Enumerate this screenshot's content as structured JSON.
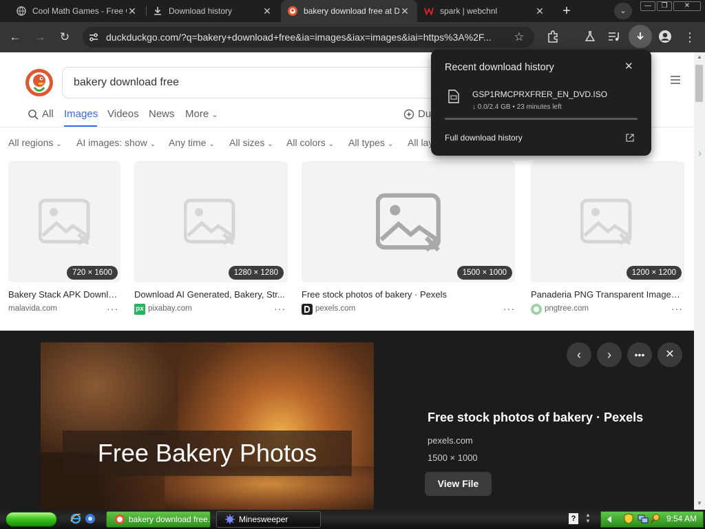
{
  "tabs": [
    {
      "title": "Cool Math Games - Free O",
      "close": "✕"
    },
    {
      "title": "Download history",
      "close": "✕"
    },
    {
      "title": "bakery download free at D",
      "close": "✕"
    },
    {
      "title": "spark | webchnl",
      "close": "✕"
    }
  ],
  "toolbar": {
    "url": "duckduckgo.com/?q=bakery+download+free&ia=images&iax=images&iai=https%3A%2F..."
  },
  "search": {
    "query": "bakery download free",
    "nav": {
      "all": "All",
      "images": "Images",
      "videos": "Videos",
      "news": "News",
      "more": "More",
      "duck_partial": "Du"
    }
  },
  "filters": [
    "All regions",
    "AI images: show",
    "Any time",
    "All sizes",
    "All colors",
    "All types",
    "All lay"
  ],
  "results": [
    {
      "dims": "720 × 1600",
      "title": "Bakery Stack APK Download",
      "source": "malavida.com",
      "more": "···"
    },
    {
      "dims": "1280 × 1280",
      "title": "Download AI Generated, Bakery, Str...",
      "source": "pixabay.com",
      "source_icon_text": "px",
      "more": "···"
    },
    {
      "dims": "1500 × 1000",
      "title": "Free stock photos of bakery · Pexels",
      "source": "pexels.com",
      "more": "···"
    },
    {
      "dims": "1200 × 1200",
      "title": "Panaderia PNG Transparent Images ...",
      "source": "pngtree.com",
      "more": "···"
    }
  ],
  "preview": {
    "image_caption": "Free Bakery Photos",
    "title": "Free stock photos of bakery · Pexels",
    "source": "pexels.com",
    "dims": "1500 × 1000",
    "view_file": "View File"
  },
  "download_popup": {
    "title": "Recent download history",
    "filename": "GSP1RMCPRXFRER_EN_DVD.ISO",
    "status": "↓ 0.0/2.4 GB • 23 minutes left",
    "full_history": "Full download history",
    "progress": 0.0
  },
  "taskbar": {
    "task1": "bakery download free...",
    "task2": "Minesweeper",
    "clock": "9:54 AM"
  }
}
